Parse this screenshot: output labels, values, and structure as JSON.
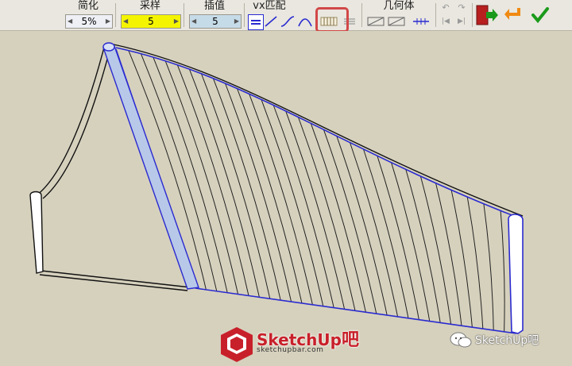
{
  "toolbar": {
    "simplify": {
      "title": "简化",
      "value": "5%"
    },
    "sampling": {
      "title": "采样",
      "value": "5"
    },
    "interpolate": {
      "title": "插值",
      "value": "5"
    },
    "vx_match": {
      "title": "vx匹配",
      "icons": [
        "equal-lines-icon",
        "straight-line-icon",
        "s-curve-icon",
        "arc-icon",
        "parallel-lines-icon",
        "stack-lines-icon"
      ]
    },
    "geometry": {
      "title": "几何体",
      "icons": [
        "rect-diagonal-icon",
        "rect-diagonal-alt-icon",
        "hash-lines-icon"
      ]
    },
    "history": {
      "icons": [
        "undo-icon",
        "redo-icon",
        "skip-back-icon",
        "skip-forward-icon"
      ]
    },
    "actions": {
      "icons": [
        "exit-door-icon",
        "back-arrow-icon",
        "confirm-check-icon"
      ]
    }
  },
  "colors": {
    "highlight": "#d24848",
    "accent_blue": "#2a2ad0",
    "viewport_bg": "#d6d1bd",
    "confirm_green": "#1a9a1a",
    "exit_red": "#b81f1f",
    "back_orange": "#f08a12"
  },
  "watermark": {
    "brand": "SketchUp",
    "brand_suffix": "吧",
    "site": "sketchupbar.com",
    "wechat_label": "SketchUp吧"
  }
}
